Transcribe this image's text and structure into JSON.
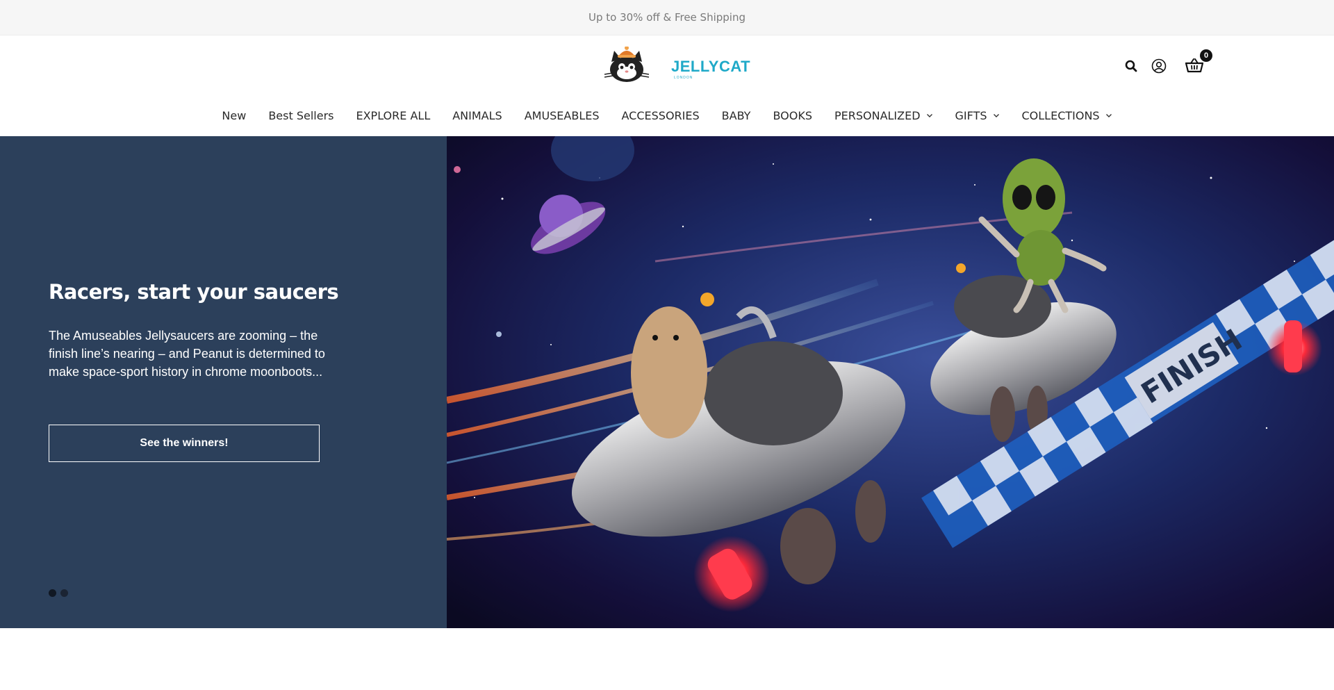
{
  "announcement": {
    "text": "Up to 30% off & Free Shipping"
  },
  "header": {
    "logo_text": "JELLYCAT",
    "logo_sub": "LONDON",
    "cart_count": "0",
    "icons": {
      "search": "search-icon",
      "account": "user-icon",
      "cart": "basket-icon"
    }
  },
  "nav": {
    "items": [
      {
        "label": "New",
        "has_dropdown": false
      },
      {
        "label": "Best Sellers",
        "has_dropdown": false
      },
      {
        "label": "EXPLORE ALL",
        "has_dropdown": false
      },
      {
        "label": "ANIMALS",
        "has_dropdown": false
      },
      {
        "label": "AMUSEABLES",
        "has_dropdown": false
      },
      {
        "label": "ACCESSORIES",
        "has_dropdown": false
      },
      {
        "label": "BABY",
        "has_dropdown": false
      },
      {
        "label": "BOOKS",
        "has_dropdown": false
      },
      {
        "label": "PERSONALIZED",
        "has_dropdown": true
      },
      {
        "label": "GIFTS",
        "has_dropdown": true
      },
      {
        "label": "COLLECTIONS",
        "has_dropdown": true
      }
    ]
  },
  "hero": {
    "title": "Racers, start your saucers",
    "description": "The Amuseables Jellysaucers are zooming – the finish line’s nearing – and Peanut is determined to make space-sport history in chrome moonboots...",
    "cta_label": "See the winners!",
    "banner_text": "FINISH",
    "slide_count": 2,
    "active_slide": 1,
    "colors": {
      "panel": "#2c405b",
      "accent": "#1fa9c8"
    }
  }
}
